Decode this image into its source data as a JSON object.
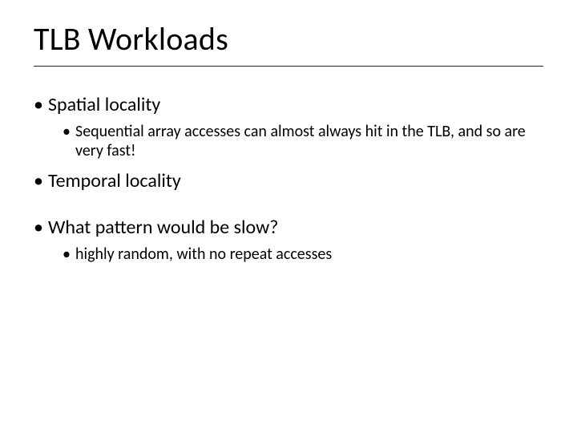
{
  "title": "TLB Workloads",
  "bullets": {
    "b1": {
      "text": "Spatial locality",
      "sub1": "Sequential array accesses can almost always hit in the TLB, and so are very fast!"
    },
    "b2": {
      "text": "Temporal locality"
    },
    "b3": {
      "text": "What pattern would be slow?",
      "sub1": "highly random, with no repeat accesses"
    }
  },
  "glyphs": {
    "dot": "•"
  }
}
